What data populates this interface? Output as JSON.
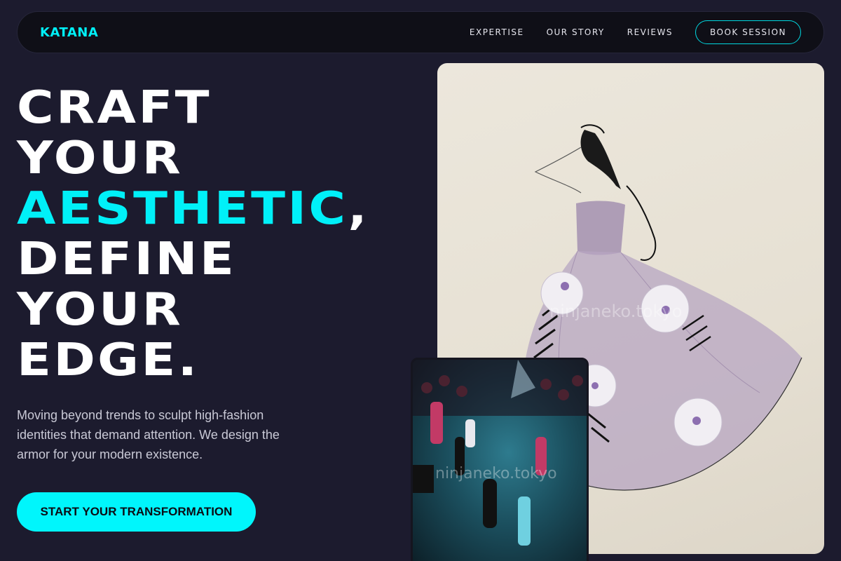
{
  "nav": {
    "logo": "KATANA",
    "links": [
      "EXPERTISE",
      "OUR STORY",
      "REVIEWS"
    ],
    "cta": "BOOK SESSION"
  },
  "hero": {
    "line1": "CRAFT",
    "line2": "YOUR",
    "line3_accent": "AESTHETIC",
    "line3_comma": ",",
    "line4": "DEFINE",
    "line5": "YOUR",
    "line6": "EDGE.",
    "description": "Moving beyond trends to sculpt high-fashion identities that demand attention. We design the armor for your modern existence.",
    "cta": "START YOUR TRANSFORMATION"
  },
  "images": {
    "watermark": "ninjaneko.tokyo"
  },
  "colors": {
    "accent": "#00f0f8",
    "background": "#1c1b2e"
  }
}
